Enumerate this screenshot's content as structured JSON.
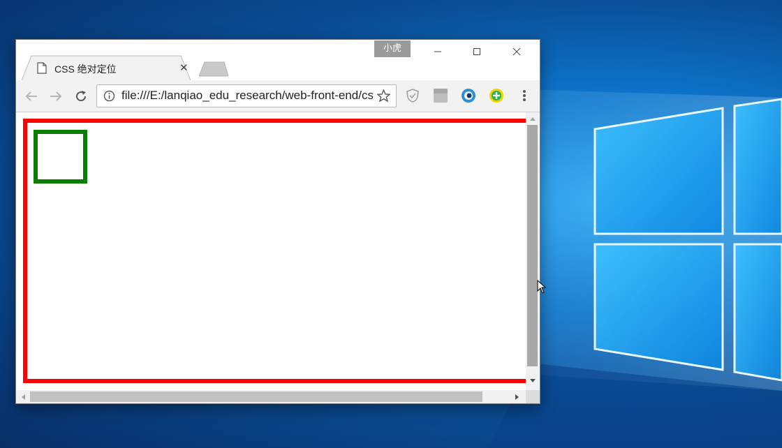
{
  "desktop": {
    "wallpaper": "windows-10-hero",
    "accent_color": "#0a6fd0"
  },
  "window": {
    "user_badge": "小虎",
    "controls": {
      "minimize": "minimize-icon",
      "maximize": "maximize-icon",
      "close": "close-icon"
    }
  },
  "tabs": [
    {
      "title": "CSS 绝对定位",
      "icon": "document-icon",
      "active": true
    }
  ],
  "toolbar": {
    "url": "file:///E:/lanqiao_edu_research/web-front-end/css",
    "extensions": [
      "shield-extension-icon",
      "es-extension-icon",
      "eye-extension-icon",
      "green-plus-extension-icon"
    ]
  },
  "page": {
    "outer_border_color": "#ff0000",
    "inner_border_color": "#0a7d00"
  },
  "scrollbars": {
    "vertical_thumb_fraction": 0.92,
    "horizontal_thumb_fraction": 0.92
  }
}
